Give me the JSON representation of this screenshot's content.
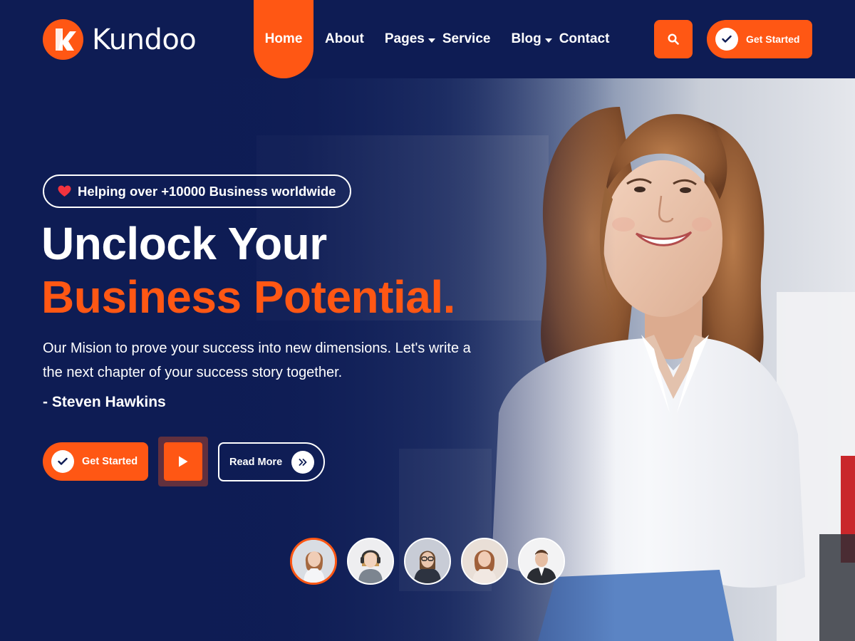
{
  "brand": {
    "name": "Kundoo",
    "accent": "#ff5714",
    "navy": "#0e1c54"
  },
  "nav": {
    "items": [
      {
        "label": "Home",
        "active": true
      },
      {
        "label": "About"
      },
      {
        "label": "Pages",
        "dropdown": true
      },
      {
        "label": "Service"
      },
      {
        "label": "Blog",
        "dropdown": true
      },
      {
        "label": "Contact"
      }
    ],
    "search_icon": "search-icon",
    "cta_label": "Get Started"
  },
  "hero": {
    "badge_icon": "heart-icon",
    "badge_text": "Helping over +10000 Business worldwide",
    "headline_line1": "Unclock Your",
    "headline_line2": "Business Potential.",
    "mission": "Our Mision to prove your success into new dimensions. Let's write a the next chapter of your success story together.",
    "author": "- Steven Hawkins",
    "cta_label": "Get Started",
    "play_icon": "play-icon",
    "read_more_label": "Read More",
    "read_more_icon": "double-chevron-right-icon",
    "thumbnails": [
      "slide-1",
      "slide-2",
      "slide-3",
      "slide-4",
      "slide-5"
    ],
    "active_thumbnail": 1
  }
}
